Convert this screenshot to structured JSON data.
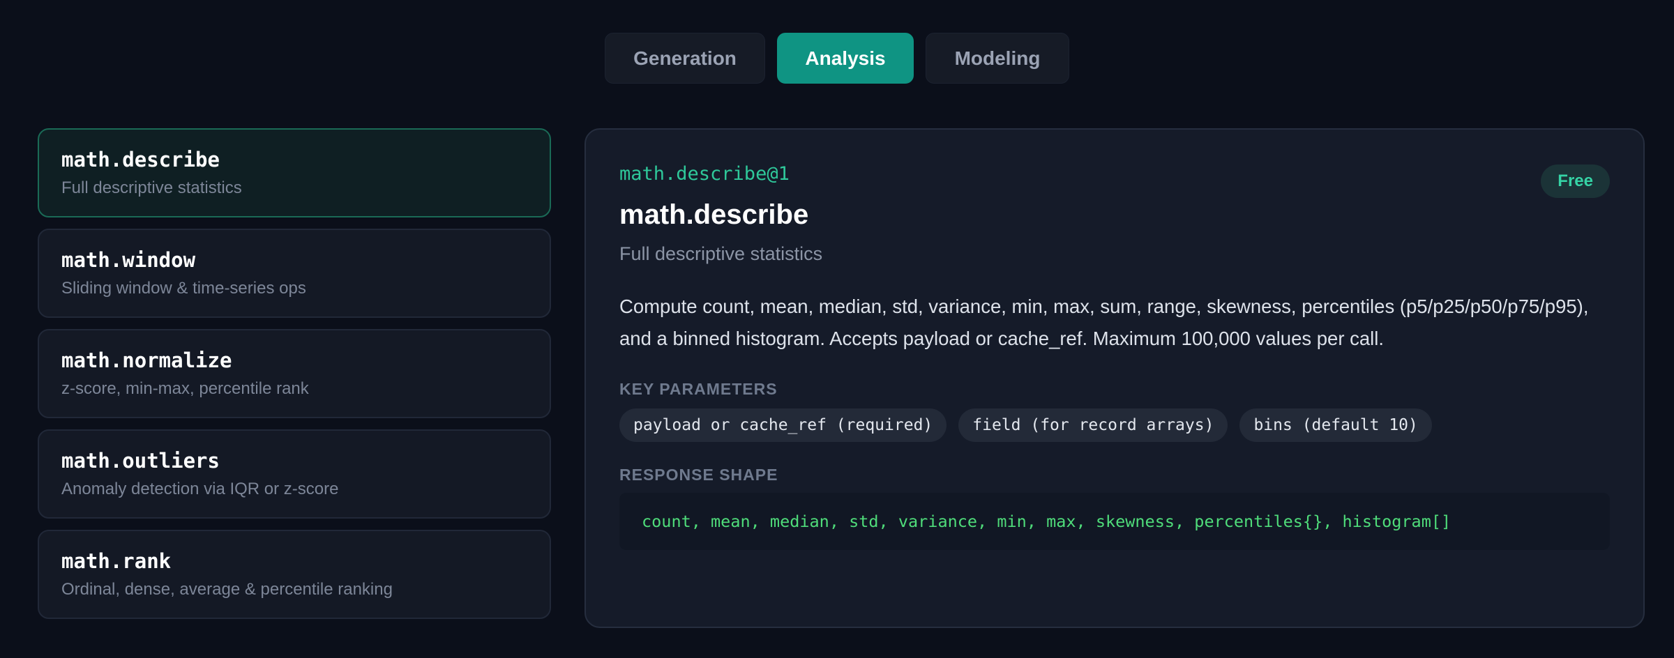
{
  "tabs": [
    {
      "label": "Generation",
      "active": false
    },
    {
      "label": "Analysis",
      "active": true
    },
    {
      "label": "Modeling",
      "active": false
    }
  ],
  "list": [
    {
      "name": "math.describe",
      "desc": "Full descriptive statistics",
      "selected": true
    },
    {
      "name": "math.window",
      "desc": "Sliding window & time-series ops",
      "selected": false
    },
    {
      "name": "math.normalize",
      "desc": "z-score, min-max, percentile rank",
      "selected": false
    },
    {
      "name": "math.outliers",
      "desc": "Anomaly detection via IQR or z-score",
      "selected": false
    },
    {
      "name": "math.rank",
      "desc": "Ordinal, dense, average & percentile ranking",
      "selected": false
    }
  ],
  "detail": {
    "id": "math.describe@1",
    "badge": "Free",
    "title": "math.describe",
    "subtitle": "Full descriptive statistics",
    "description": "Compute count, mean, median, std, variance, min, max, sum, range, skewness, percentiles (p5/p25/p50/p75/p95), and a binned histogram. Accepts payload or cache_ref. Maximum 100,000 values per call.",
    "params_label": "KEY PARAMETERS",
    "params": [
      "payload or cache_ref (required)",
      "field (for record arrays)",
      "bins (default 10)"
    ],
    "response_label": "RESPONSE SHAPE",
    "response": "count, mean, median, std, variance, min, max, skewness, percentiles{}, histogram[]"
  },
  "colors": {
    "background": "#0b0f1a",
    "accent": "#0f9483",
    "code_green": "#4fdc7a",
    "id_green": "#2fc89a"
  }
}
